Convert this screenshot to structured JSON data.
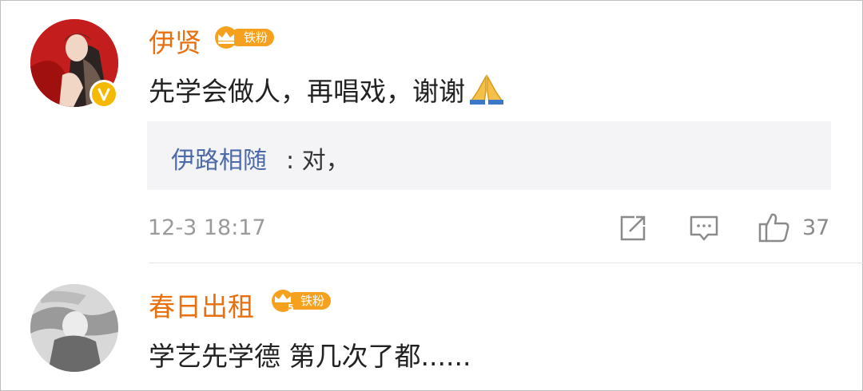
{
  "comments": [
    {
      "username": "伊贤",
      "badge": "铁粉",
      "text": "先学会做人，再唱戏，谢谢",
      "reply": {
        "user": "伊路相随",
        "text": ": 对，"
      },
      "timestamp": "12-3 18:17",
      "likes": "37",
      "icons": [
        "share-icon",
        "comment-icon",
        "like-icon",
        "folded-hands-emoji",
        "verified-badge"
      ]
    },
    {
      "username": "春日出租",
      "badge": "铁粉",
      "crown_level": "5",
      "text": "学艺先学德 第几次了都......"
    }
  ],
  "colors": {
    "username": "#e8700e",
    "reply_user": "#4d6aa8",
    "badge": "#f6a11e",
    "verified": "#f5b900",
    "meta": "#9a9a9a"
  }
}
